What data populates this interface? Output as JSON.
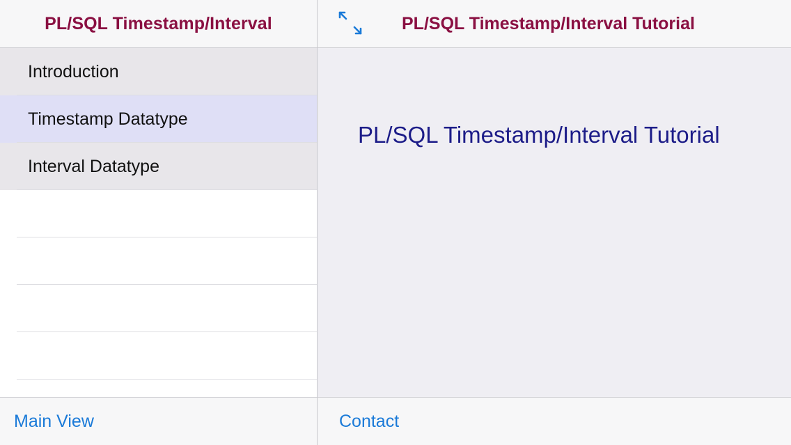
{
  "master": {
    "title": "PL/SQL Timestamp/Interval",
    "items": [
      {
        "label": "Introduction"
      },
      {
        "label": "Timestamp Datatype"
      },
      {
        "label": "Interval Datatype"
      }
    ],
    "selected_index": 1,
    "toolbar_link": "Main View"
  },
  "detail": {
    "title": "PL/SQL Timestamp/Interval Tutorial",
    "expand_icon": "expand-arrows-icon",
    "content_heading": "PL/SQL Timestamp/Interval Tutorial",
    "toolbar_link": "Contact"
  },
  "colors": {
    "nav_title": "#8a1042",
    "link": "#1a7ad8",
    "content_heading": "#1c1c88",
    "selected_row": "#dfdff6",
    "row": "#e8e6ea",
    "detail_background": "#efeef3"
  }
}
